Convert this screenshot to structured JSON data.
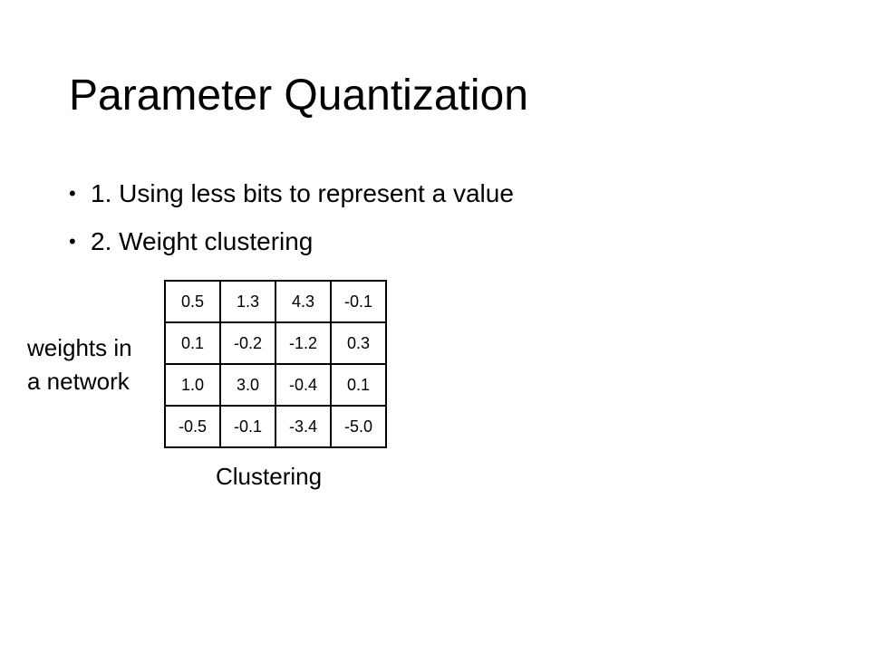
{
  "slide": {
    "title": "Parameter Quantization",
    "bullets": [
      "1. Using less bits to represent a value",
      "2. Weight clustering"
    ],
    "bullet_marker": "•"
  },
  "figure": {
    "side_label_lines": [
      "weights in",
      "a network"
    ],
    "caption": "Clustering",
    "weights": [
      [
        "0.5",
        "1.3",
        "4.3",
        "-0.1"
      ],
      [
        "0.1",
        "-0.2",
        "-1.2",
        "0.3"
      ],
      [
        "1.0",
        "3.0",
        "-0.4",
        "0.1"
      ],
      [
        "-0.5",
        "-0.1",
        "-3.4",
        "-5.0"
      ]
    ]
  }
}
